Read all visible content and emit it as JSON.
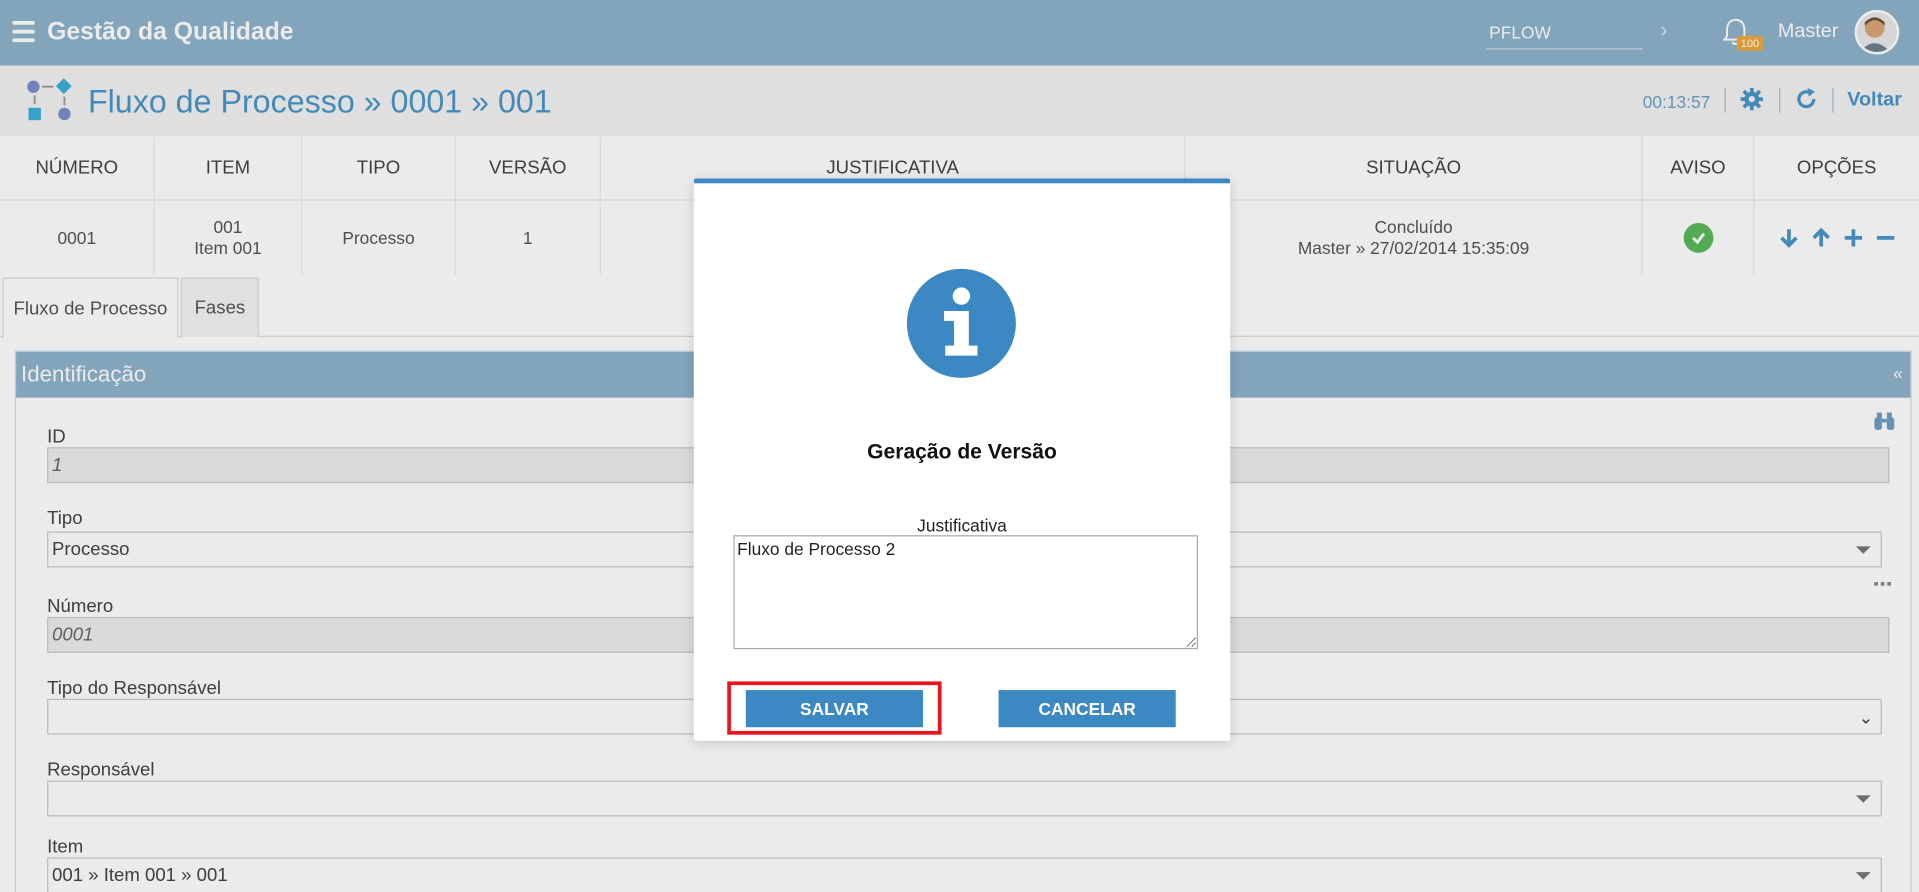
{
  "header": {
    "app_title": "Gestão da Qualidade",
    "pflow_value": "PFLOW",
    "notification_count": "100",
    "user_name": "Master",
    "bar_color": "#8fb3cb"
  },
  "page": {
    "title": "Fluxo de Processo » 0001 » 001",
    "timer": "00:13:57",
    "back_label": "Voltar",
    "accent_color": "#4a96c8"
  },
  "grid": {
    "columns": [
      "NÚMERO",
      "ITEM",
      "TIPO",
      "VERSÃO",
      "JUSTIFICATIVA",
      "SITUAÇÃO",
      "AVISO",
      "OPÇÕES"
    ],
    "row": {
      "numero": "0001",
      "item_line1": "001",
      "item_line2": "Item 001",
      "tipo": "Processo",
      "versao": "1",
      "justificativa": "",
      "situacao_line1": "Concluído",
      "situacao_line2": "Master » 27/02/2014 15:35:09",
      "aviso_icon": "check-circle-icon",
      "opcoes_icons": [
        "arrow-down-icon",
        "arrow-up-icon",
        "plus-icon",
        "minus-icon"
      ]
    }
  },
  "tabs": [
    {
      "label": "Fluxo de Processo",
      "active": true
    },
    {
      "label": "Fases",
      "active": false
    }
  ],
  "panel": {
    "title": "Identificação",
    "collapse_label": "«",
    "fields": {
      "id_label": "ID",
      "id_value": "1",
      "tipo_label": "Tipo",
      "tipo_value": "Processo",
      "numero_label": "Número",
      "numero_value": "0001",
      "tipo_resp_label": "Tipo do Responsável",
      "tipo_resp_value": "",
      "responsavel_label": "Responsável",
      "responsavel_value": "",
      "item_label": "Item",
      "item_value": "001 » Item 001 » 001"
    }
  },
  "modal": {
    "icon": "info-icon",
    "title": "Geração de Versão",
    "field_label": "Justificativa",
    "field_value": "Fluxo de Processo 2",
    "save_label": "SALVAR",
    "cancel_label": "CANCELAR",
    "button_color": "#3b88c3",
    "highlight_color": "#e8161c"
  }
}
